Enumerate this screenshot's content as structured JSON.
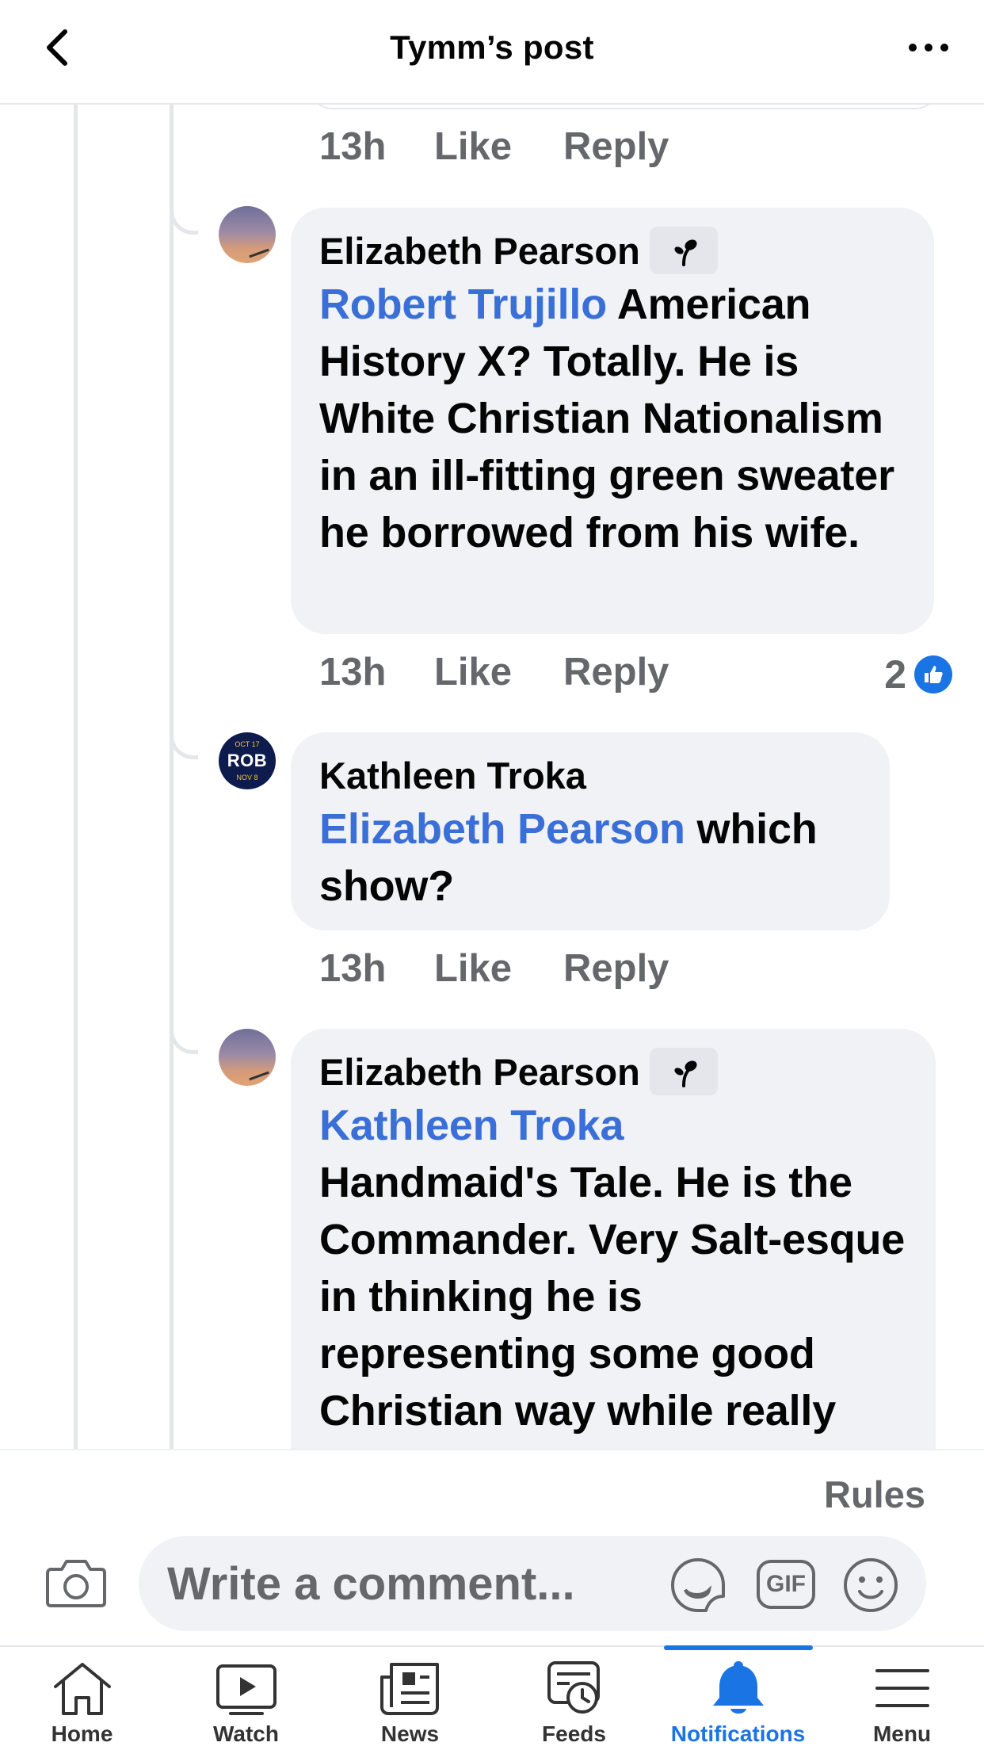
{
  "header": {
    "title": "Tymm’s post"
  },
  "comments": [
    {
      "time": "13h",
      "like": "Like",
      "reply": "Reply"
    },
    {
      "author": "Elizabeth Pearson",
      "mention": "Robert Trujillo",
      "text": " American History X? Totally. He is White Christian Nationalism in an ill-fitting green sweater he borrowed from his wife.",
      "time": "13h",
      "like": "Like",
      "reply": "Reply",
      "reaction_count": "2"
    },
    {
      "author": "Kathleen Troka",
      "avatar_text": "ROB",
      "avatar_top": "OCT 17",
      "avatar_bottom": "NOV 8",
      "mention": "Elizabeth Pearson",
      "text": " which show?",
      "time": "13h",
      "like": "Like",
      "reply": "Reply"
    },
    {
      "author": "Elizabeth Pearson",
      "mention": "Kathleen Troka",
      "text": "Handmaid's Tale. He is the Commander. Very Salt-esque in thinking he is representing some good Christian way while really"
    }
  ],
  "composer": {
    "rules": "Rules",
    "placeholder": "Write a comment...",
    "gif": "GIF"
  },
  "tabbar": {
    "items": [
      {
        "label": "Home",
        "icon": "home-icon"
      },
      {
        "label": "Watch",
        "icon": "watch-icon"
      },
      {
        "label": "News",
        "icon": "news-icon"
      },
      {
        "label": "Feeds",
        "icon": "feeds-icon"
      },
      {
        "label": "Notifications",
        "icon": "bell-icon",
        "active": true
      },
      {
        "label": "Menu",
        "icon": "menu-icon"
      }
    ]
  },
  "colors": {
    "accent": "#1b74e4",
    "mention": "#3a6fd8",
    "bubble": "#f0f2f5",
    "secondary_text": "#65676b"
  }
}
